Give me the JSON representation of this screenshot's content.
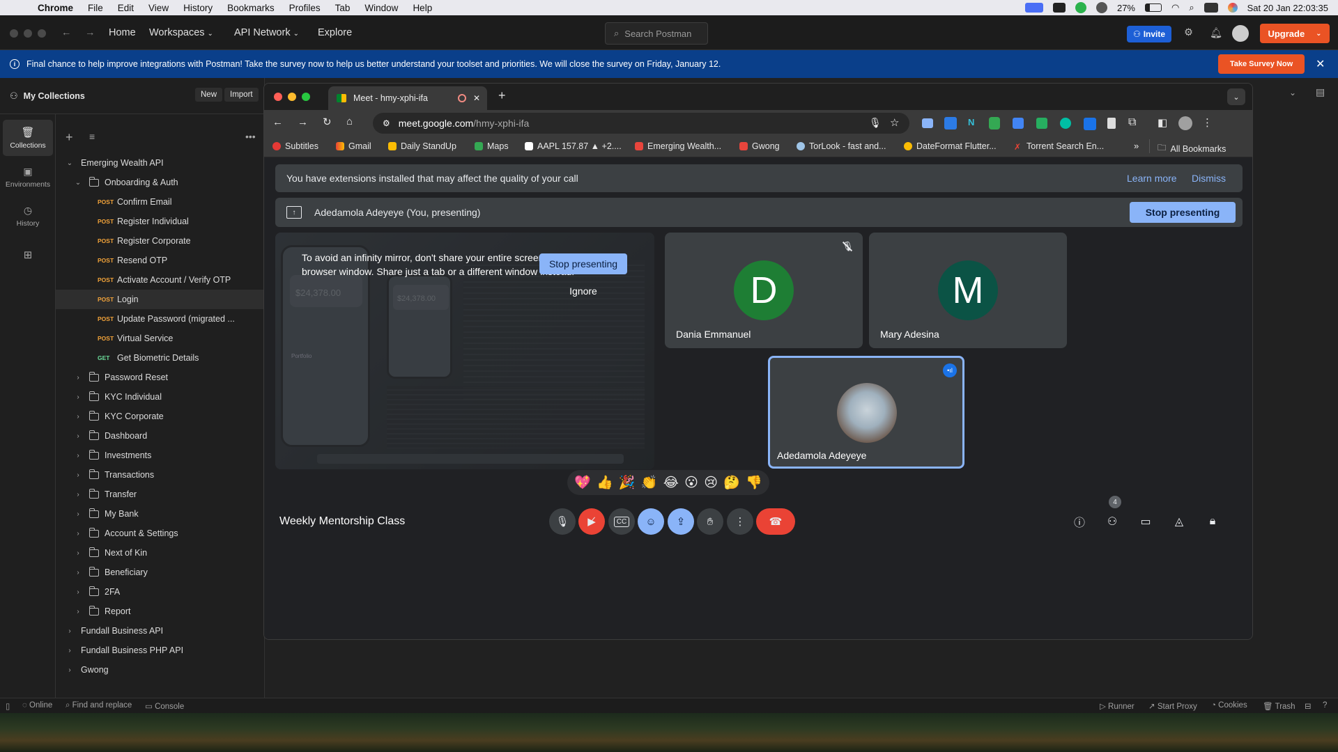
{
  "menubar": {
    "app": "Chrome",
    "items": [
      "File",
      "Edit",
      "View",
      "History",
      "Bookmarks",
      "Profiles",
      "Tab",
      "Window",
      "Help"
    ],
    "battery": "27%",
    "datetime": "Sat 20 Jan  22:03:35"
  },
  "postman": {
    "nav": {
      "home": "Home",
      "workspaces": "Workspaces",
      "api_network": "API Network",
      "explore": "Explore"
    },
    "search_placeholder": "Search Postman",
    "invite": "Invite",
    "upgrade": "Upgrade",
    "banner": {
      "text": "Final chance to help improve integrations with Postman! Take the survey now to help us better understand your toolset and priorities. We will close the survey on Friday, January 12.",
      "cta": "Take Survey Now"
    },
    "sidebar": {
      "title": "My Collections",
      "new": "New",
      "import": "Import",
      "rail": [
        {
          "label": "Collections",
          "icon": "collections-icon"
        },
        {
          "label": "Environments",
          "icon": "environments-icon"
        },
        {
          "label": "History",
          "icon": "history-icon"
        }
      ],
      "tree": [
        {
          "type": "collection",
          "label": "Emerging Wealth API",
          "level": 0,
          "open": true
        },
        {
          "type": "folder",
          "label": "Onboarding & Auth",
          "level": 1,
          "open": true
        },
        {
          "type": "request",
          "method": "POST",
          "label": "Confirm Email"
        },
        {
          "type": "request",
          "method": "POST",
          "label": "Register Individual"
        },
        {
          "type": "request",
          "method": "POST",
          "label": "Register Corporate"
        },
        {
          "type": "request",
          "method": "POST",
          "label": "Resend OTP"
        },
        {
          "type": "request",
          "method": "POST",
          "label": "Activate Account / Verify OTP"
        },
        {
          "type": "request",
          "method": "POST",
          "label": "Login",
          "selected": true
        },
        {
          "type": "request",
          "method": "POST",
          "label": "Update Password (migrated ..."
        },
        {
          "type": "request",
          "method": "POST",
          "label": "Virtual Service"
        },
        {
          "type": "request",
          "method": "GET",
          "label": "Get Biometric Details"
        },
        {
          "type": "folder",
          "label": "Password Reset",
          "level": 1
        },
        {
          "type": "folder",
          "label": "KYC Individual",
          "level": 1
        },
        {
          "type": "folder",
          "label": "KYC Corporate",
          "level": 1
        },
        {
          "type": "folder",
          "label": "Dashboard",
          "level": 1
        },
        {
          "type": "folder",
          "label": "Investments",
          "level": 1
        },
        {
          "type": "folder",
          "label": "Transactions",
          "level": 1
        },
        {
          "type": "folder",
          "label": "Transfer",
          "level": 1
        },
        {
          "type": "folder",
          "label": "My Bank",
          "level": 1
        },
        {
          "type": "folder",
          "label": "Account & Settings",
          "level": 1
        },
        {
          "type": "folder",
          "label": "Next of Kin",
          "level": 1
        },
        {
          "type": "folder",
          "label": "Beneficiary",
          "level": 1
        },
        {
          "type": "folder",
          "label": "2FA",
          "level": 1
        },
        {
          "type": "folder",
          "label": "Report",
          "level": 1
        },
        {
          "type": "collection",
          "label": "Fundall Business API",
          "level": 0
        },
        {
          "type": "collection",
          "label": "Fundall Business PHP API",
          "level": 0
        },
        {
          "type": "collection",
          "label": "Gwong",
          "level": 0
        }
      ]
    },
    "status": {
      "online": "Online",
      "find": "Find and replace",
      "console": "Console",
      "runner": "Runner",
      "proxy": "Start Proxy",
      "cookies": "Cookies",
      "trash": "Trash"
    }
  },
  "chrome": {
    "tab_title": "Meet - hmy-xphi-ifa",
    "url_host": "meet.google.com",
    "url_path": "/hmy-xphi-ifa",
    "bookmarks": [
      "Subtitles",
      "Gmail",
      "Daily StandUp",
      "Maps",
      "AAPL 157.87 ▲ +2....",
      "Emerging Wealth...",
      "Gwong",
      "TorLook - fast and...",
      "DateFormat Flutter...",
      "Torrent Search En..."
    ],
    "all_bookmarks": "All Bookmarks"
  },
  "meet": {
    "ext_warning": "You have extensions installed that may affect the quality of your call",
    "learn_more": "Learn more",
    "dismiss": "Dismiss",
    "presenter": "Adedamola Adeyeye (You, presenting)",
    "stop_presenting": "Stop presenting",
    "mirror_warning": "To avoid an infinity mirror, don't share your entire screen or browser window. Share just a tab or a different window instead.",
    "ignore": "Ignore",
    "participants": [
      {
        "name": "Dania Emmanuel",
        "initial": "D",
        "color": "#1e7e34"
      },
      {
        "name": "Mary Adesina",
        "initial": "M",
        "color": "#0b5345"
      },
      {
        "name": "Adedamola Adeyeye",
        "initial": ""
      }
    ],
    "meeting_name": "Weekly Mentorship Class",
    "participant_count": "4",
    "reactions": [
      "💖",
      "👍",
      "🎉",
      "👏",
      "😂",
      "😮",
      "😢",
      "🤔",
      "👎"
    ],
    "share_preview": {
      "balance_1": "$24,378.00",
      "balance_2": "$24,378.00",
      "portfolio": "Portfolio"
    }
  }
}
